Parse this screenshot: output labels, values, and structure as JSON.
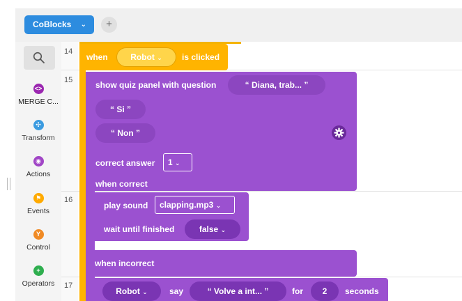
{
  "topbar": {
    "project_tab_label": "CoBlocks",
    "add_tab_label": "+"
  },
  "sidebar": {
    "categories": [
      {
        "label": "MERGE C...",
        "icon": "merge-cube-icon",
        "color": "#9b27b0",
        "glyph": "<>"
      },
      {
        "label": "Transform",
        "icon": "transform-icon",
        "color": "#3b9be0",
        "glyph": "✣"
      },
      {
        "label": "Actions",
        "icon": "actions-icon",
        "color": "#a146c6",
        "glyph": "◉"
      },
      {
        "label": "Events",
        "icon": "events-icon",
        "color": "#ffaa00",
        "glyph": "⚑"
      },
      {
        "label": "Control",
        "icon": "control-icon",
        "color": "#f08a24",
        "glyph": "Y"
      },
      {
        "label": "Operators",
        "icon": "operators-icon",
        "color": "#2eae4e",
        "glyph": "+"
      }
    ]
  },
  "lines": [
    "14",
    "15",
    "16",
    "17"
  ],
  "blocks": {
    "event": {
      "when": "when",
      "target": "Robot",
      "clicked": "is clicked"
    },
    "quiz": {
      "label": "show quiz panel with question",
      "question": "“ Diana, trab... ”",
      "option1": "“ Si ”",
      "option2": "“ Non ”",
      "correct_label": "correct answer",
      "correct_value": "1",
      "when_correct": "when correct",
      "when_incorrect": "when incorrect"
    },
    "sound": {
      "label": "play sound",
      "file": "clapping.mp3",
      "wait_label": "wait until finished",
      "wait_value": "false"
    },
    "say": {
      "target": "Robot",
      "say": "say",
      "text": "“ Volve a int... ”",
      "for": "for",
      "seconds_value": "2",
      "seconds": "seconds"
    }
  },
  "colors": {
    "accent_blue": "#2d8cdf",
    "event_yellow": "#ffb400",
    "block_purple": "#9b51d0"
  }
}
